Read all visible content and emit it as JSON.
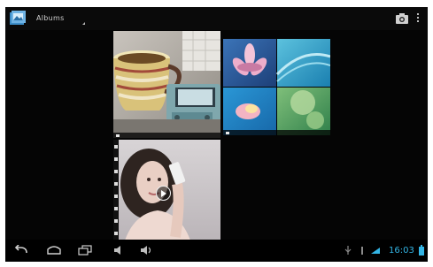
{
  "action_bar": {
    "app_icon": "gallery-icon",
    "title": "Albums",
    "camera_icon": "camera-icon",
    "overflow_icon": "overflow-menu-icon"
  },
  "albums": [
    {
      "name": "",
      "thumbnail": "photo-mug-handheld"
    },
    {
      "name": "",
      "thumbnail": "photo-wallpapers-flowers"
    },
    {
      "name": "",
      "thumbnail": "video-woman-phone",
      "has_video_icon": "play-icon"
    }
  ],
  "nav_bar": {
    "back_icon": "back-icon",
    "home_icon": "home-icon",
    "recents_icon": "recent-apps-icon",
    "volume_down_icon": "volume-down-icon",
    "volume_up_icon": "volume-up-icon",
    "clock": "16:03",
    "status_icons": [
      "usb-icon",
      "signal-icon",
      "wifi-icon",
      "battery-icon"
    ]
  },
  "colors": {
    "background": "#050505",
    "accent": "#33b5e5"
  }
}
